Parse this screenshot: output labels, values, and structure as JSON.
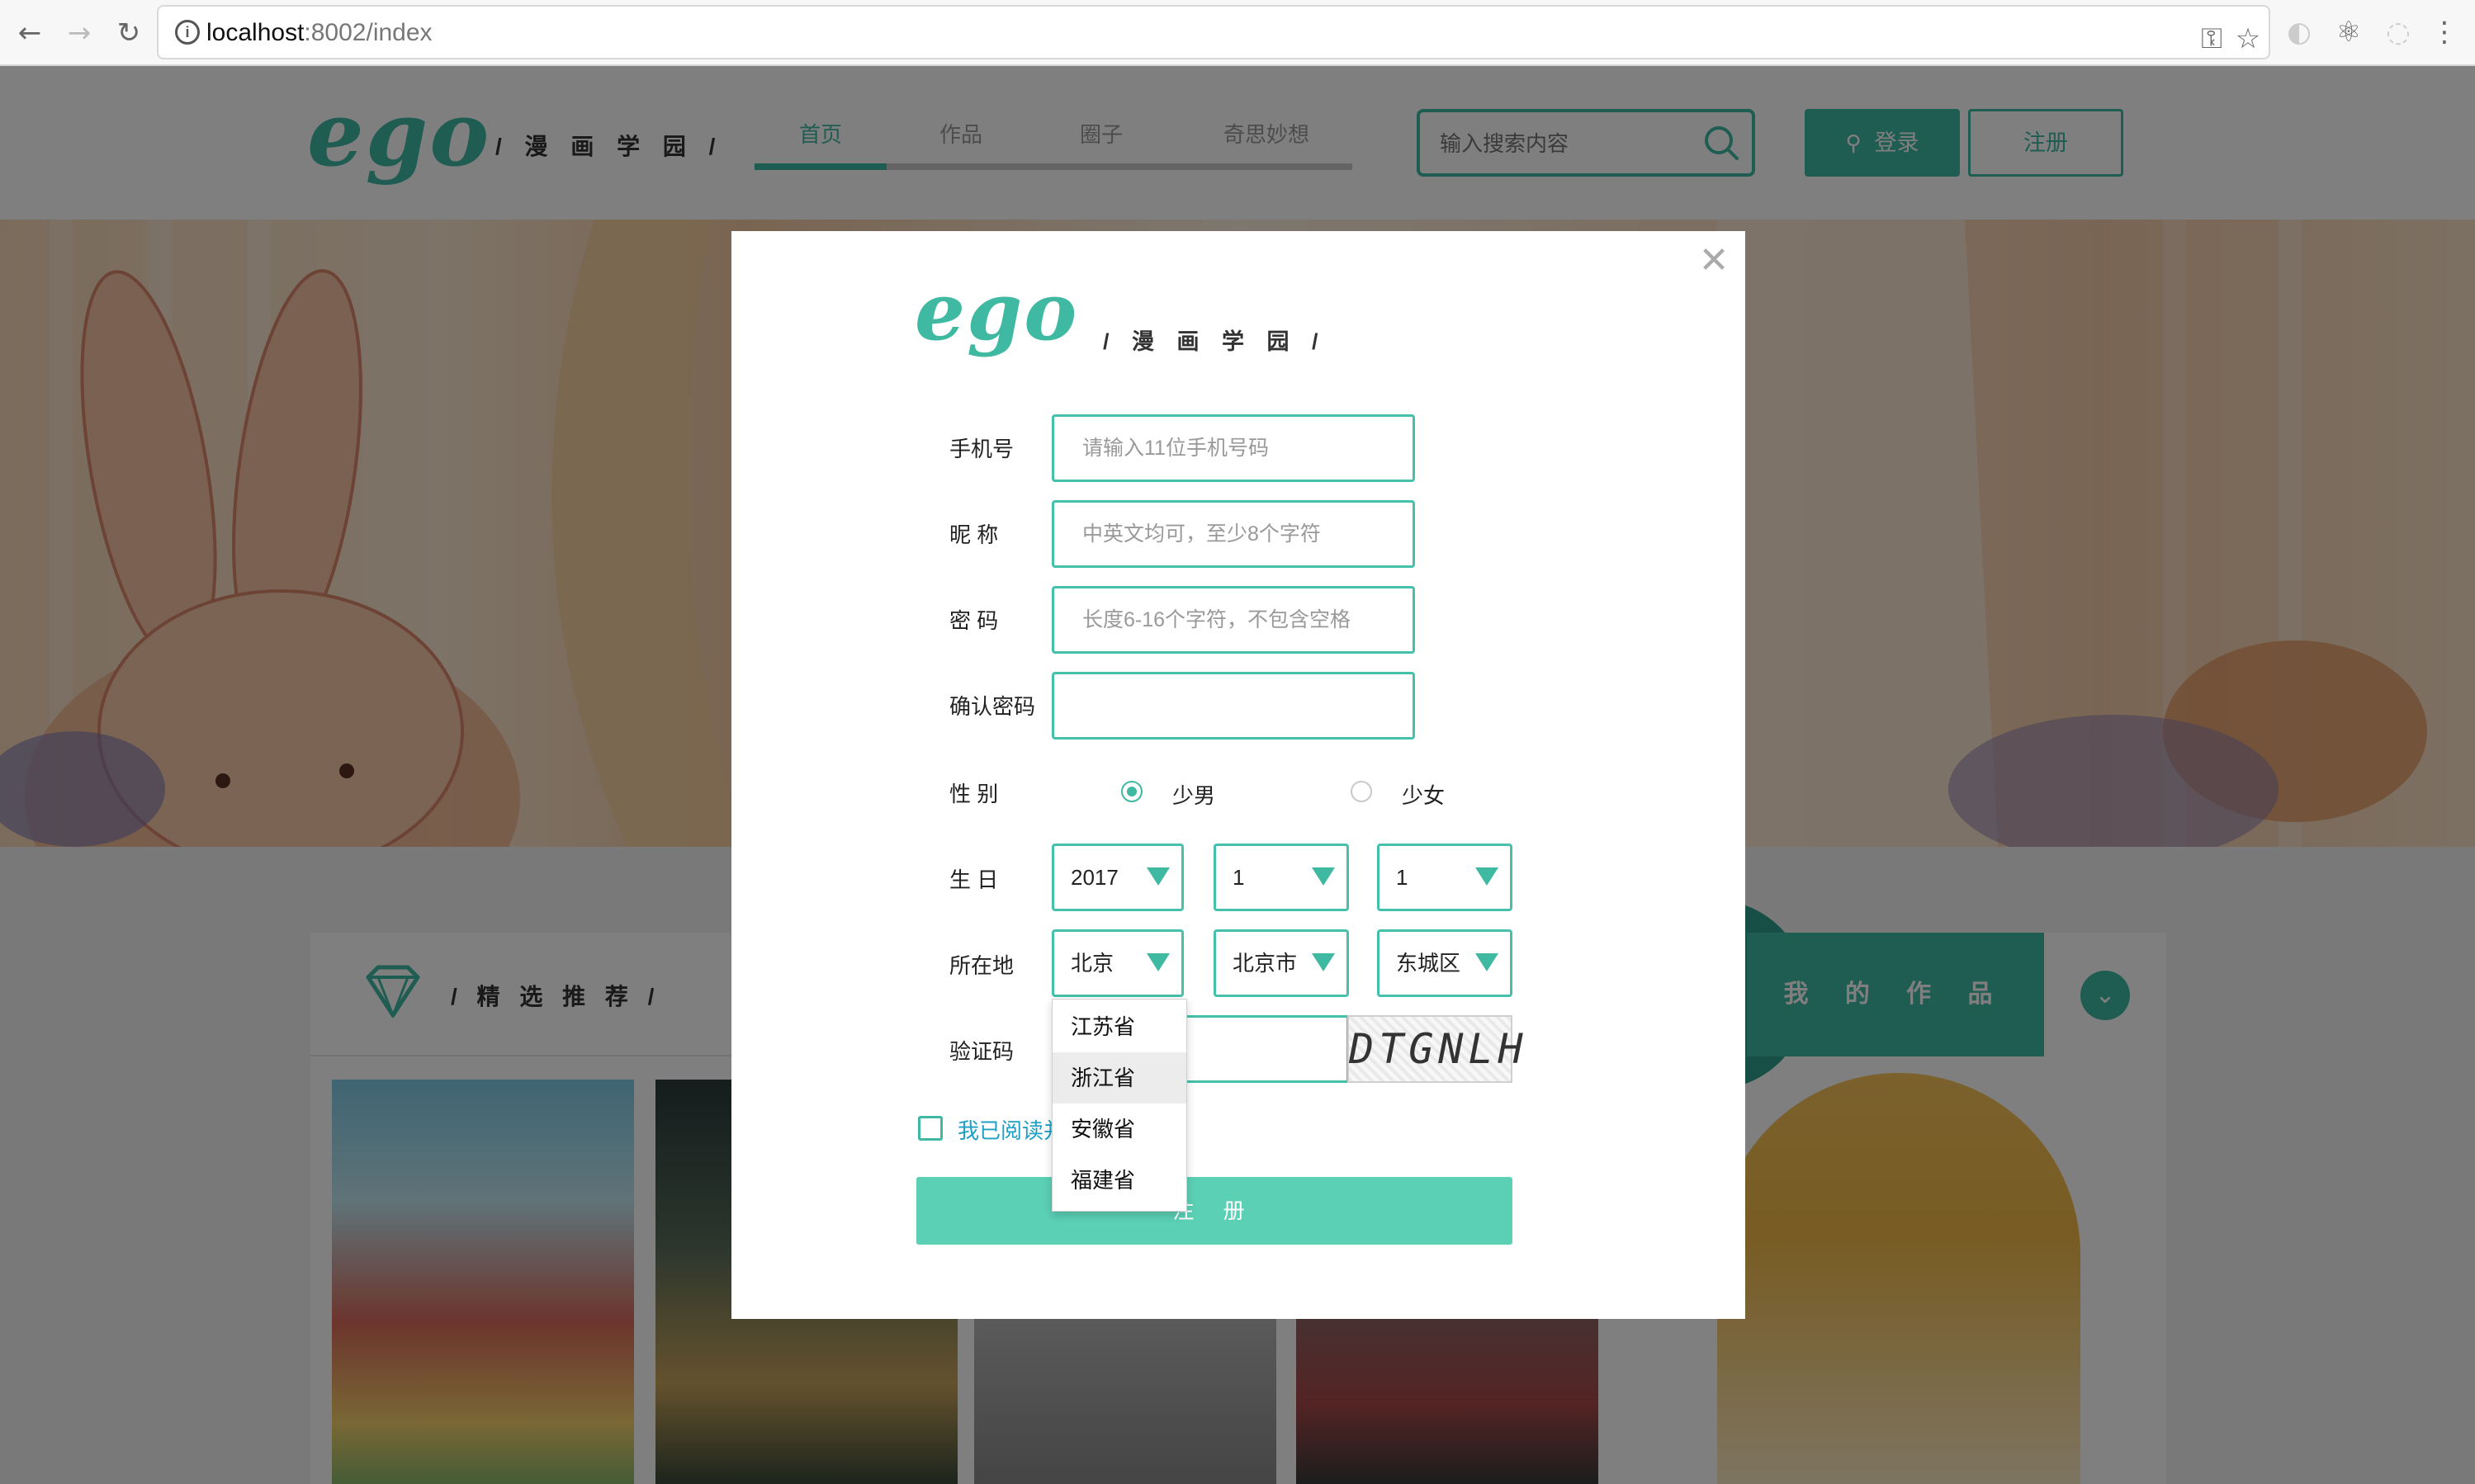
{
  "browser": {
    "url_host": "localhost",
    "url_rest": ":8002/index"
  },
  "header": {
    "logo": "ego",
    "logo_sub": "/ 漫 画 学 园 /",
    "nav_tabs": [
      "首页",
      "作品",
      "圈子",
      "奇思妙想"
    ],
    "active_tab": 0,
    "search_placeholder": "输入搜索内容",
    "login_label": "登录",
    "register_label": "注册"
  },
  "page": {
    "recommend_title": "/ 精 选 推 荐 /",
    "my_works_label": "我 的 作 品"
  },
  "modal": {
    "logo": "ego",
    "logo_sub": "/ 漫 画 学 园 /",
    "close_symbol": "✕",
    "phone_label": "手机号",
    "phone_placeholder": "请输入11位手机号码",
    "nick_label": "昵 称",
    "nick_placeholder": "中英文均可，至少8个字符",
    "password_label": "密 码",
    "password_placeholder": "长度6-16个字符，不包含空格",
    "confirm_label": "确认密码",
    "confirm_placeholder": "",
    "gender_label": "性 别",
    "gender_options": [
      "少男",
      "少女"
    ],
    "gender_selected": 0,
    "birthday_label": "生 日",
    "birthday": {
      "year": "2017",
      "month": "1",
      "day": "1"
    },
    "location_label": "所在地",
    "location": {
      "province": "北京",
      "city": "北京市",
      "district": "东城区"
    },
    "province_options_visible": [
      "江苏省",
      "浙江省",
      "安徽省",
      "福建省"
    ],
    "province_highlighted": 1,
    "captcha_label": "验证码",
    "captcha_text": "DTGNLH",
    "agree_text": "我已阅读并",
    "submit_label": "注 册"
  },
  "colors": {
    "accent": "#3fb9a2",
    "submit": "#5bd0b5",
    "link": "#1e9fc5"
  }
}
